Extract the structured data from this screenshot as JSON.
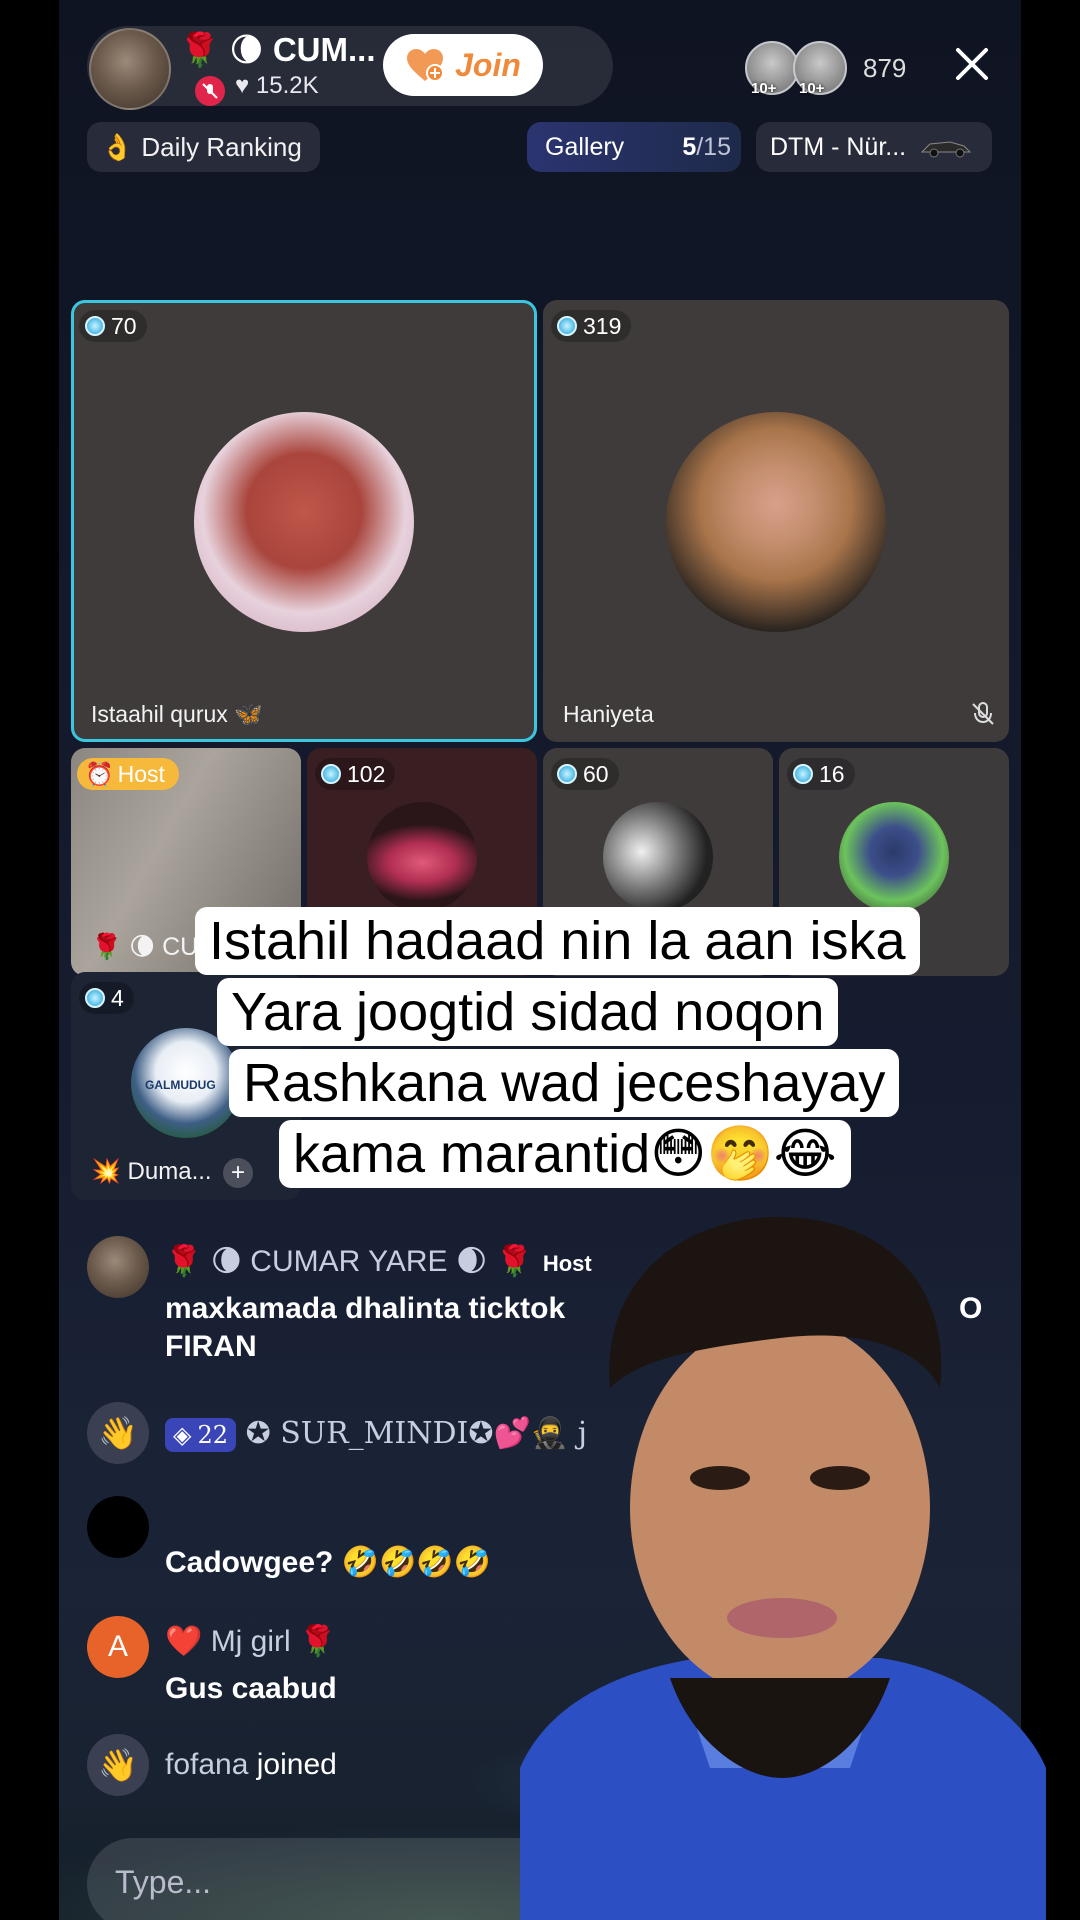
{
  "header": {
    "host_name": "🌹 🌘 CUM...",
    "host_likes": "15.2K",
    "join_label": "Join",
    "viewer_badges": [
      "10+",
      "10+"
    ],
    "viewer_count": "879",
    "close_icon": "close-icon"
  },
  "toolbar": {
    "daily_ranking": "Daily Ranking",
    "gallery_label": "Gallery",
    "gallery_current": "5",
    "gallery_total": "/15",
    "event_label": "DTM - Nür..."
  },
  "guests": {
    "big": [
      {
        "score": "70",
        "name": "Istaahil qurux 🦋"
      },
      {
        "score": "319",
        "name": "Haniyeta"
      }
    ],
    "small": [
      {
        "host_tag": "Host",
        "name": "🌹 🌘 CU"
      },
      {
        "score": "102"
      },
      {
        "score": "60"
      },
      {
        "score": "16"
      }
    ],
    "third_row": {
      "score": "4",
      "name": "💥 Duma...",
      "logo_text": "GALMUDUG"
    }
  },
  "caption": {
    "lines": [
      "Istahil hadaad nin la aan iska",
      "Yara joogtid sidad noqon",
      "Rashkana wad jeceshayay",
      "kama marantid😳🤭😂"
    ]
  },
  "chat": [
    {
      "name": "🌹 🌘 CUMAR YARE 🌒 🌹",
      "host_label": "Host",
      "message_line1": "maxkamada dhalinta ticktok",
      "message_line1_tail": "O",
      "message_line2": "FIRAN"
    },
    {
      "level": "22",
      "name": "✪ SUR_MINDI✪💕🥷 j"
    },
    {
      "name": "",
      "message": "Cadowgee? 🤣🤣🤣🤣"
    },
    {
      "avatar_letter": "A",
      "name": "❤️ Mj girl 🌹",
      "message": "Gus caabud"
    },
    {
      "name": "fofana",
      "joined_text": " joined"
    }
  ],
  "input": {
    "placeholder": "Type..."
  },
  "colors": {
    "accent_cyan": "#39c6e0",
    "join_orange": "#f08a3a",
    "host_tag": "#f6b93b",
    "mute_red": "#e1254a"
  }
}
